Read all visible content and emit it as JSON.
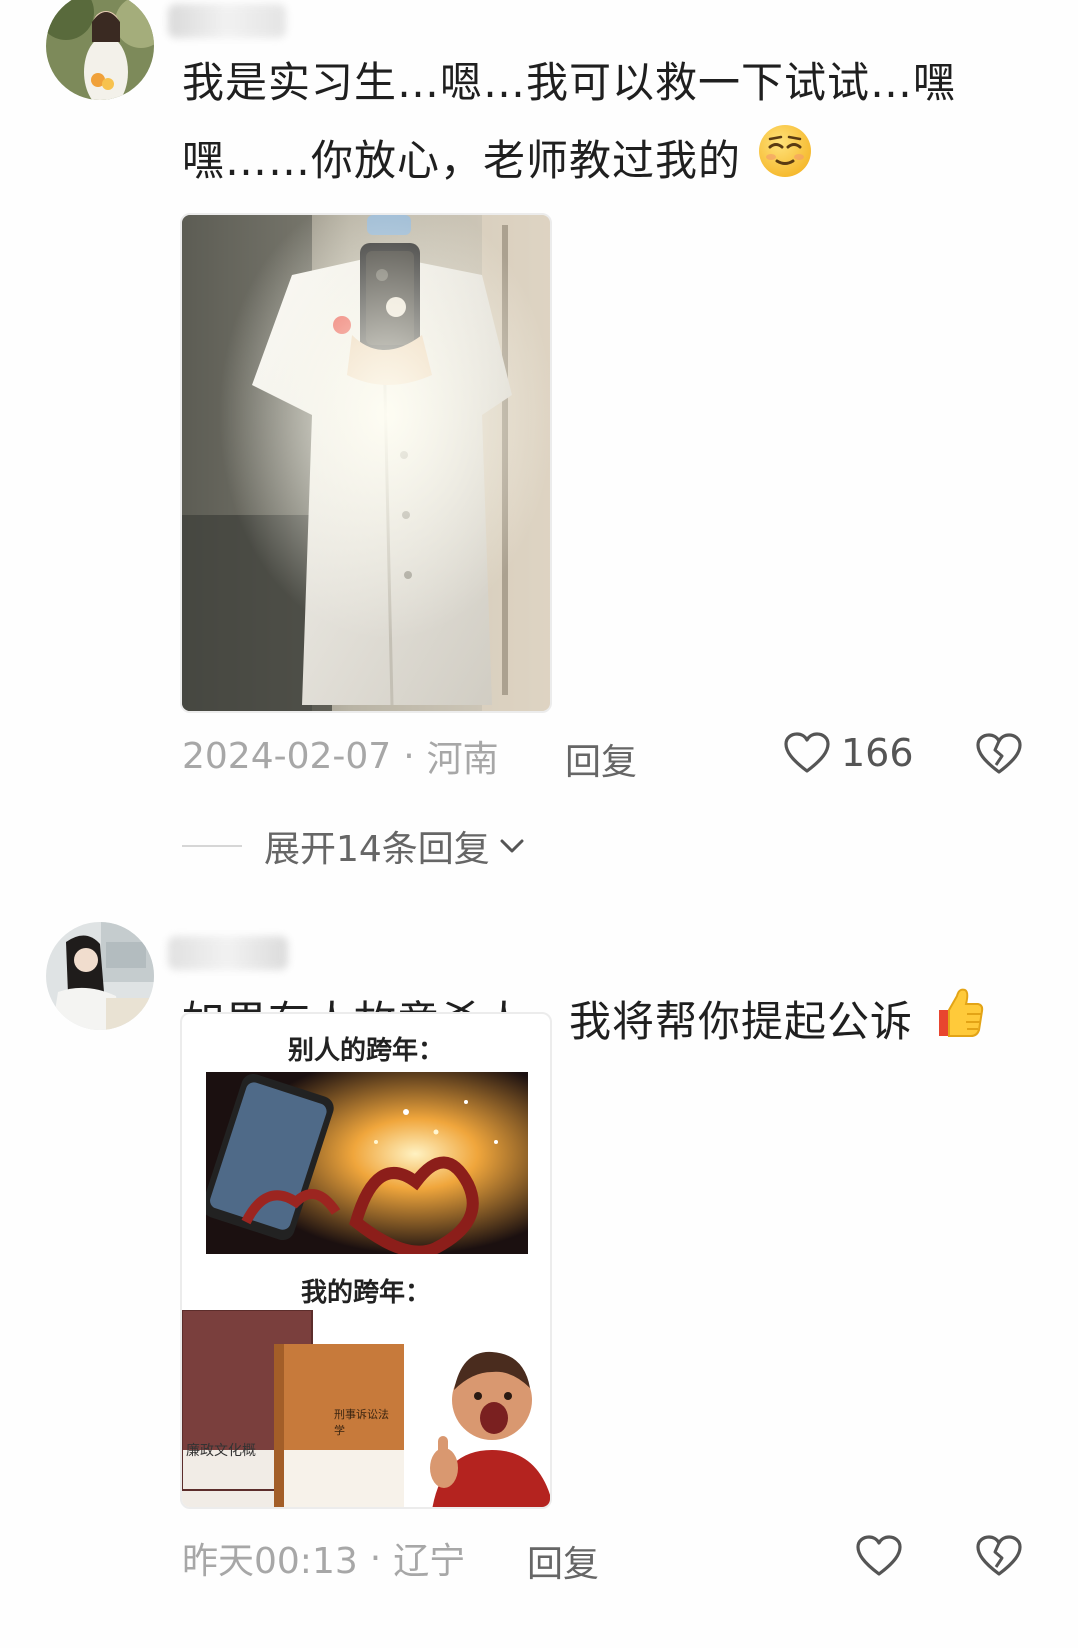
{
  "comments": [
    {
      "text_line1": "我是实习生…嗯…我可以救一下试试…嘿",
      "text_line2": "嘿……你放心，老师教过我的",
      "emoji": "relieved-face-emoji",
      "date": "2024-02-07",
      "separator": "·",
      "location": "河南",
      "reply_label": "回复",
      "like_count": "166",
      "expand_label": "展开14条回复"
    },
    {
      "text": "如果有人故意杀人，我将帮你提起公诉",
      "emoji": "thumbs-up-emoji",
      "date": "昨天00:13",
      "separator": "·",
      "location": "辽宁",
      "reply_label": "回复",
      "meme": {
        "label_top": "别人的跨年：",
        "label_bottom": "我的跨年：",
        "book1_title": "廉政文化概",
        "book2_title": "刑事诉讼法学"
      }
    }
  ],
  "icons": {
    "like": "heart-outline-icon",
    "dislike": "broken-heart-icon",
    "expand": "chevron-down-icon"
  },
  "colors": {
    "meta_text": "#a7a7a7",
    "body_text": "#1f1f1f",
    "background": "#fefefe"
  }
}
